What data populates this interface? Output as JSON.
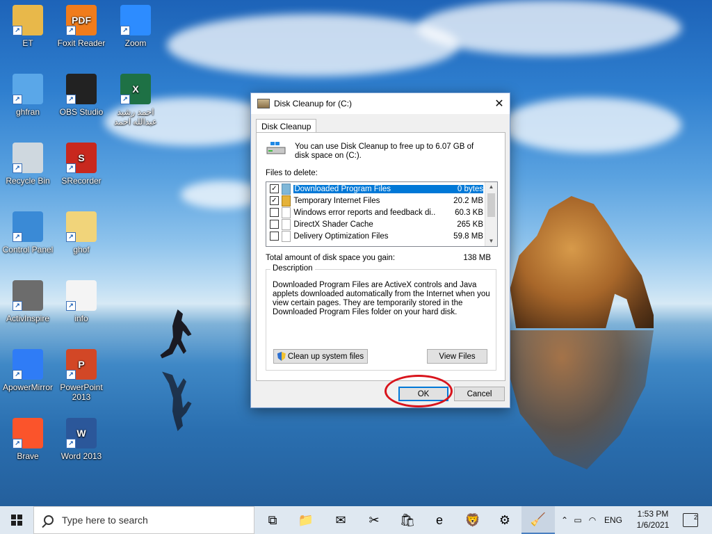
{
  "desktop": {
    "icons": [
      {
        "label": "ET",
        "icon": "user-folder-icon",
        "color": "#e8b84a"
      },
      {
        "label": "Foxit Reader",
        "icon": "pdf-icon",
        "color": "#f07c1c",
        "badge": "PDF"
      },
      {
        "label": "Zoom",
        "icon": "video-camera-icon",
        "color": "#2d8cff"
      },
      {
        "label": "ghfran",
        "icon": "computer-icon",
        "color": "#5aa7e8"
      },
      {
        "label": "OBS Studio",
        "icon": "obs-icon",
        "color": "#222222"
      },
      {
        "label": "احمد رشيد عبدالله احمد",
        "icon": "excel-file-icon",
        "color": "#1e7145",
        "badge": "X"
      },
      {
        "label": "Recycle Bin",
        "icon": "recycle-bin-icon",
        "color": "#cfd8df"
      },
      {
        "label": "SRecorder",
        "icon": "srecorder-icon",
        "color": "#c8281e",
        "badge": "S"
      },
      {
        "label": "Control Panel",
        "icon": "control-panel-icon",
        "color": "#3a8ad6"
      },
      {
        "label": "ghof",
        "icon": "folder-icon",
        "color": "#f1d47a"
      },
      {
        "label": "ActivInspire",
        "icon": "activinspire-icon",
        "color": "#6c6c6c"
      },
      {
        "label": "info",
        "icon": "text-file-icon",
        "color": "#f4f4f4"
      },
      {
        "label": "ApowerMirror",
        "icon": "apowermirror-icon",
        "color": "#2f7cf6"
      },
      {
        "label": "PowerPoint 2013",
        "icon": "powerpoint-icon",
        "color": "#d24726",
        "badge": "P"
      },
      {
        "label": "Brave",
        "icon": "brave-lion-icon",
        "color": "#fb542b"
      },
      {
        "label": "Word 2013",
        "icon": "word-icon",
        "color": "#2b579a",
        "badge": "W"
      }
    ]
  },
  "dialog": {
    "title": "Disk Cleanup for  (C:)",
    "tab": "Disk Cleanup",
    "intro": "You can use Disk Cleanup to free up to 6.07 GB of disk space on  (C:).",
    "files_label": "Files to delete:",
    "files": [
      {
        "name": "Downloaded Program Files",
        "size": "0 bytes",
        "checked": "✓"
      },
      {
        "name": "Temporary Internet Files",
        "size": "20.2 MB",
        "checked": "✓"
      },
      {
        "name": "Windows error reports and feedback di...",
        "size": "60.3 KB",
        "checked": ""
      },
      {
        "name": "DirectX Shader Cache",
        "size": "265 KB",
        "checked": ""
      },
      {
        "name": "Delivery Optimization Files",
        "size": "59.8 MB",
        "checked": ""
      }
    ],
    "total_label": "Total amount of disk space you gain:",
    "total_value": "138 MB",
    "description_legend": "Description",
    "description_text": "Downloaded Program Files are ActiveX controls and Java applets downloaded automatically from the Internet when you view certain pages. They are temporarily stored in the Downloaded Program Files folder on your hard disk.",
    "clean_button": "Clean up system files",
    "view_button": "View Files",
    "ok_button": "OK",
    "cancel_button": "Cancel",
    "close_glyph": "✕"
  },
  "taskbar": {
    "search_placeholder": "Type here to search",
    "apps": [
      {
        "name": "task-view-icon",
        "glyph": "⧉"
      },
      {
        "name": "file-explorer-icon",
        "glyph": "📁"
      },
      {
        "name": "mail-icon",
        "glyph": "✉"
      },
      {
        "name": "snipping-icon",
        "glyph": "✂"
      },
      {
        "name": "store-icon",
        "glyph": "🛍"
      },
      {
        "name": "edge-icon",
        "glyph": "e"
      },
      {
        "name": "brave-icon",
        "glyph": "🦁"
      },
      {
        "name": "settings-icon",
        "glyph": "⚙"
      },
      {
        "name": "disk-cleanup-icon",
        "glyph": "🧹"
      }
    ],
    "tray": {
      "language": "ENG",
      "time": "1:53 PM",
      "date": "1/6/2021",
      "notification_count": "2"
    }
  },
  "colors": {
    "selection": "#0078d7",
    "annotation_circle": "#d8141c",
    "taskbar": "#dfe8f1"
  }
}
